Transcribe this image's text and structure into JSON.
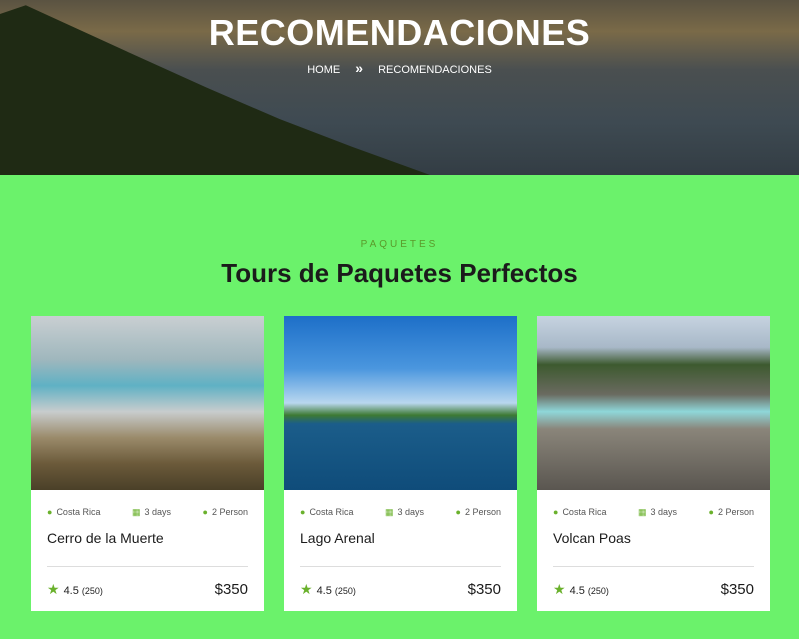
{
  "hero": {
    "title": "RECOMENDACIONES",
    "breadcrumb": {
      "home": "HOME",
      "separator": "»",
      "current": "RECOMENDACIONES"
    }
  },
  "section": {
    "subtitle": "PAQUETES",
    "title": "Tours de Paquetes Perfectos"
  },
  "accent": "#6ab12c",
  "cards": [
    {
      "location": "Costa Rica",
      "duration": "3 days",
      "people": "2 Person",
      "name": "Cerro de la Muerte",
      "rating": "4.5",
      "reviews": "(250)",
      "price": "$350"
    },
    {
      "location": "Costa Rica",
      "duration": "3 days",
      "people": "2 Person",
      "name": "Lago Arenal",
      "rating": "4.5",
      "reviews": "(250)",
      "price": "$350"
    },
    {
      "location": "Costa Rica",
      "duration": "3 days",
      "people": "2 Person",
      "name": "Volcan Poas",
      "rating": "4.5",
      "reviews": "(250)",
      "price": "$350"
    }
  ]
}
